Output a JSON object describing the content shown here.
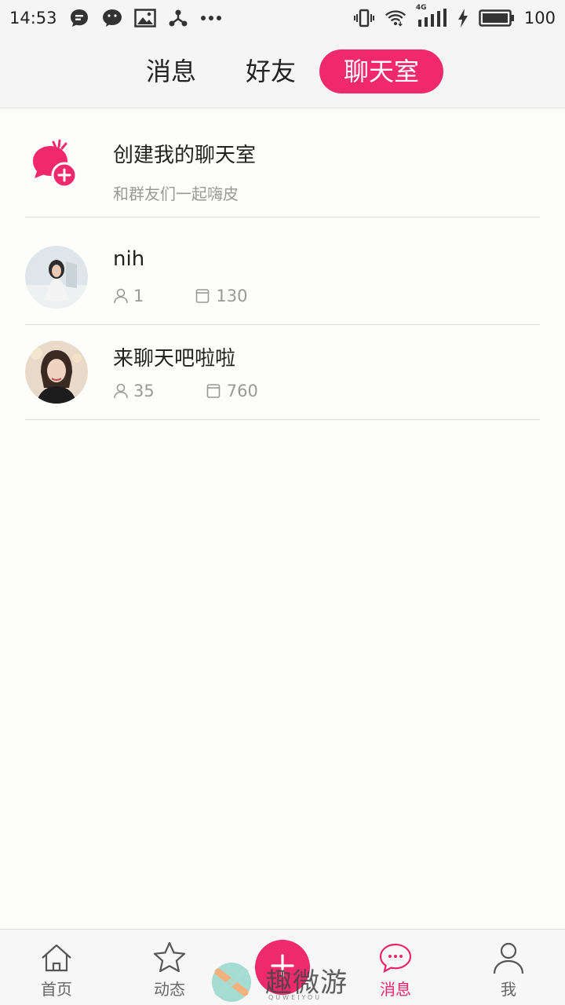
{
  "status_bar": {
    "time": "14:53",
    "left_icons": [
      "chat-bubble-icon",
      "wechat-icon",
      "image-icon",
      "share-icon",
      "more-dots-icon"
    ],
    "right_icons": [
      "vibrate-icon",
      "wifi-icon",
      "signal-4g-icon",
      "charging-icon",
      "battery-icon"
    ],
    "network_label": "4G",
    "battery": "100"
  },
  "top_tabs": {
    "items": [
      {
        "label": "消息",
        "active": false
      },
      {
        "label": "好友",
        "active": false
      },
      {
        "label": "聊天室",
        "active": true
      }
    ]
  },
  "create_room": {
    "title": "创建我的聊天室",
    "subtitle": "和群友们一起嗨皮",
    "icon": "create-chat-icon"
  },
  "rooms": [
    {
      "name": "nih",
      "members": "1",
      "messages": "130"
    },
    {
      "name": "来聊天吧啦啦",
      "members": "35",
      "messages": "760"
    }
  ],
  "bottom_nav": {
    "items": [
      {
        "label": "首页",
        "icon": "home-icon"
      },
      {
        "label": "动态",
        "icon": "star-icon"
      },
      {
        "label": "消息",
        "icon": "message-icon",
        "active": true
      },
      {
        "label": "我",
        "icon": "user-icon"
      }
    ],
    "add_button_icon": "plus-icon"
  },
  "watermark": {
    "text": "趣微游",
    "sub": "QUWEIYOU"
  },
  "colors": {
    "accent": "#f0296d",
    "background": "#fdfdfb",
    "header_bg": "#f5f5f5",
    "muted_text": "#999999"
  }
}
